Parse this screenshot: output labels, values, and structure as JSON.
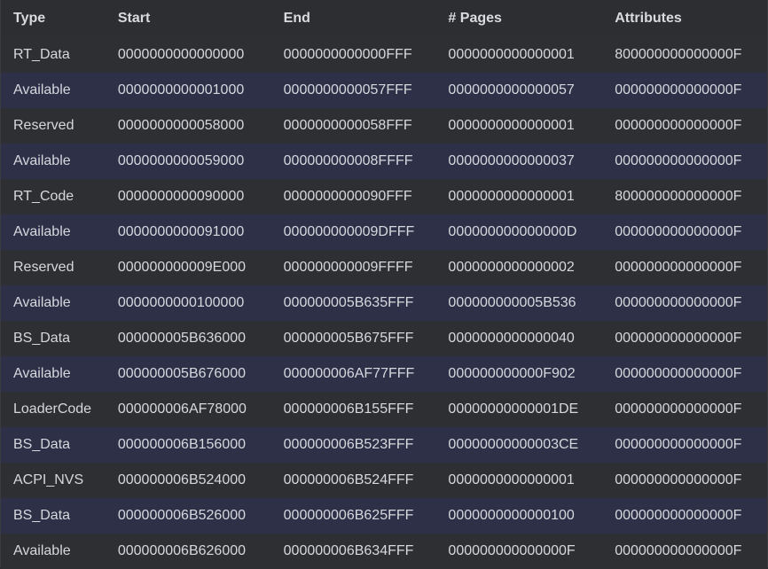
{
  "table": {
    "columns": [
      "Type",
      "Start",
      "End",
      "# Pages",
      "Attributes"
    ],
    "rows": [
      [
        "RT_Data",
        "0000000000000000",
        "0000000000000FFF",
        "0000000000000001",
        "800000000000000F"
      ],
      [
        "Available",
        "0000000000001000",
        "0000000000057FFF",
        "0000000000000057",
        "000000000000000F"
      ],
      [
        "Reserved",
        "0000000000058000",
        "0000000000058FFF",
        "0000000000000001",
        "000000000000000F"
      ],
      [
        "Available",
        "0000000000059000",
        "000000000008FFFF",
        "0000000000000037",
        "000000000000000F"
      ],
      [
        "RT_Code",
        "0000000000090000",
        "0000000000090FFF",
        "0000000000000001",
        "800000000000000F"
      ],
      [
        "Available",
        "0000000000091000",
        "000000000009DFFF",
        "000000000000000D",
        "000000000000000F"
      ],
      [
        "Reserved",
        "000000000009E000",
        "000000000009FFFF",
        "0000000000000002",
        "000000000000000F"
      ],
      [
        "Available",
        "0000000000100000",
        "000000005B635FFF",
        "000000000005B536",
        "000000000000000F"
      ],
      [
        "BS_Data",
        "000000005B636000",
        "000000005B675FFF",
        "0000000000000040",
        "000000000000000F"
      ],
      [
        "Available",
        "000000005B676000",
        "000000006AF77FFF",
        "000000000000F902",
        "000000000000000F"
      ],
      [
        "LoaderCode",
        "000000006AF78000",
        "000000006B155FFF",
        "00000000000001DE",
        "000000000000000F"
      ],
      [
        "BS_Data",
        "000000006B156000",
        "000000006B523FFF",
        "00000000000003CE",
        "000000000000000F"
      ],
      [
        "ACPI_NVS",
        "000000006B524000",
        "000000006B524FFF",
        "0000000000000001",
        "000000000000000F"
      ],
      [
        "BS_Data",
        "000000006B526000",
        "000000006B625FFF",
        "0000000000000100",
        "000000000000000F"
      ],
      [
        "Available",
        "000000006B626000",
        "000000006B634FFF",
        "000000000000000F",
        "000000000000000F"
      ]
    ]
  }
}
